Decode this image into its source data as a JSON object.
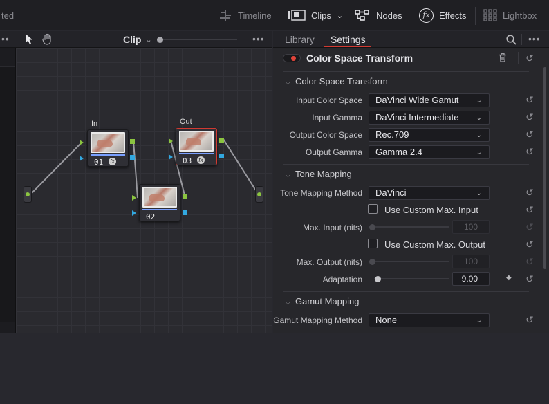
{
  "topbar": {
    "left_truncated": "ted",
    "timeline": "Timeline",
    "clips": "Clips",
    "nodes": "Nodes",
    "effects": "Effects",
    "lightbox": "Lightbox"
  },
  "node_editor": {
    "mode": "Clip",
    "in_label": "In",
    "out_label": "Out",
    "nodes": [
      {
        "id": "01"
      },
      {
        "id": "02"
      },
      {
        "id": "03"
      }
    ]
  },
  "panel": {
    "tabs": [
      {
        "label": "Library"
      },
      {
        "label": "Settings"
      }
    ],
    "active_tab": "Settings",
    "effect_title": "Color Space Transform",
    "effect_enabled": true,
    "sections": {
      "cst": "Color Space Transform",
      "tone": "Tone Mapping",
      "gamut": "Gamut Mapping"
    },
    "fields": {
      "input_color_space": {
        "label": "Input Color Space",
        "value": "DaVinci Wide Gamut"
      },
      "input_gamma": {
        "label": "Input Gamma",
        "value": "DaVinci Intermediate"
      },
      "output_color_space": {
        "label": "Output Color Space",
        "value": "Rec.709"
      },
      "output_gamma": {
        "label": "Output Gamma",
        "value": "Gamma 2.4"
      },
      "tone_mapping_method": {
        "label": "Tone Mapping Method",
        "value": "DaVinci"
      },
      "use_custom_max_input": {
        "label": "Use Custom Max. Input",
        "checked": false
      },
      "max_input": {
        "label": "Max. Input (nits)",
        "value": "100"
      },
      "use_custom_max_output": {
        "label": "Use Custom Max. Output",
        "checked": false
      },
      "max_output": {
        "label": "Max. Output (nits)",
        "value": "100"
      },
      "adaptation": {
        "label": "Adaptation",
        "value": "9.00"
      },
      "gamut_mapping_method": {
        "label": "Gamut Mapping Method",
        "value": "None"
      }
    }
  },
  "colors": {
    "accent_red": "#d13a32",
    "pin_green": "#8bc440",
    "pin_blue": "#32a8e0",
    "tab_underline": "#d13a32"
  }
}
